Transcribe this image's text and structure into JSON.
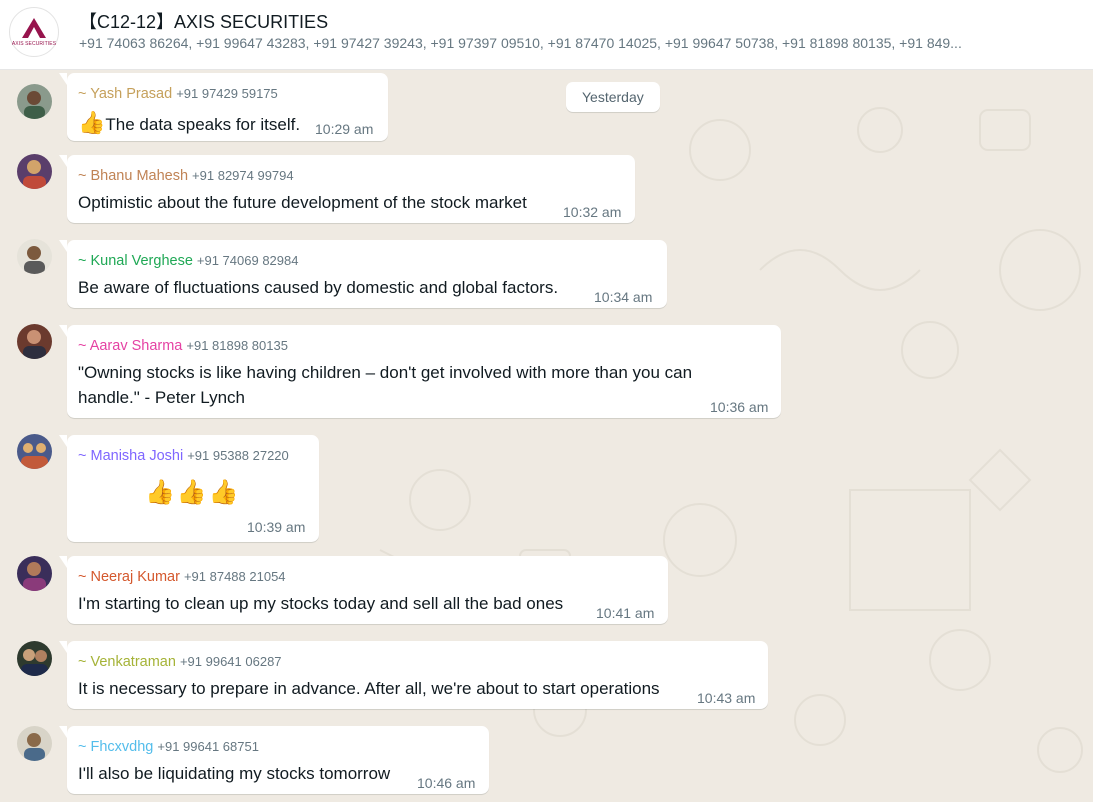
{
  "header": {
    "logo_text": "AXIS SECURITIES",
    "title": "【C12-12】AXIS SECURITIES",
    "members": "+91 74063 86264, +91 99647 43283, +91 97427 39243, +91 97397 09510, +91 87470 14025, +91 99647 50738, +91 81898 80135, +91 849..."
  },
  "date_separator": "Yesterday",
  "messages": [
    {
      "name": "~ Yash Prasad",
      "phone": "+91 97429 59175",
      "text": "The data speaks for itself.",
      "time": "10:29 am",
      "color": "#c5a05b"
    },
    {
      "name": "~ Bhanu Mahesh",
      "phone": "+91 82974 99794",
      "text": "Optimistic about the future development of the stock market",
      "time": "10:32 am",
      "color": "#c08355"
    },
    {
      "name": "~ Kunal Verghese",
      "phone": "+91 74069 82984",
      "text": "Be aware of fluctuations caused by domestic and global factors.",
      "time": "10:34 am",
      "color": "#1fa855"
    },
    {
      "name": "~ Aarav Sharma",
      "phone": "+91 81898 80135",
      "text": "\"Owning stocks is like having children – don't get involved with more than you can handle.\" - Peter Lynch",
      "time": "10:36 am",
      "color": "#e542a3"
    },
    {
      "name": "~ Manisha Joshi",
      "phone": "+91 95388 27220",
      "text": "",
      "time": "10:39 am",
      "color": "#7f66ff"
    },
    {
      "name": "~ Neeraj Kumar",
      "phone": "+91 87488 21054",
      "text": "I'm starting to clean up my stocks today and sell all the bad ones",
      "time": "10:41 am",
      "color": "#d4582d"
    },
    {
      "name": "~ Venkatraman",
      "phone": "+91 99641 06287",
      "text": "It is necessary to prepare in advance. After all, we're about to start operations",
      "time": "10:43 am",
      "color": "#a5b337"
    },
    {
      "name": "~ Fhcxvdhg",
      "phone": "+91 99641 68751",
      "text": "I'll also be liquidating my stocks tomorrow",
      "time": "10:46 am",
      "color": "#53bdeb"
    }
  ]
}
